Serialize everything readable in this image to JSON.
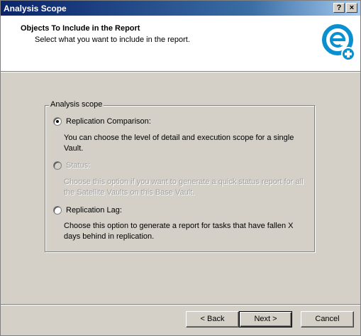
{
  "window": {
    "title": "Analysis Scope",
    "help_label": "?",
    "close_label": "×"
  },
  "header": {
    "title": "Objects To Include in the Report",
    "subtitle": "Select what you want to include in the report."
  },
  "group": {
    "label": "Analysis scope"
  },
  "options": [
    {
      "label": "Replication Comparison:",
      "selected": true,
      "enabled": true,
      "description": "You can choose the level of detail and execution scope for a single Vault."
    },
    {
      "label": "Status:",
      "selected": false,
      "enabled": false,
      "description": "Choose this option if you want to generate a quick status report for all the Satellite Vaults on this Base Vault."
    },
    {
      "label": "Replication Lag:",
      "selected": false,
      "enabled": true,
      "description": "Choose this option to generate a report for tasks that have fallen X days behind in replication."
    }
  ],
  "buttons": {
    "back": "< Back",
    "next": "Next >",
    "cancel": "Cancel"
  },
  "colors": {
    "logo": "#0a8fcf",
    "titlebar": "#0a246a"
  }
}
